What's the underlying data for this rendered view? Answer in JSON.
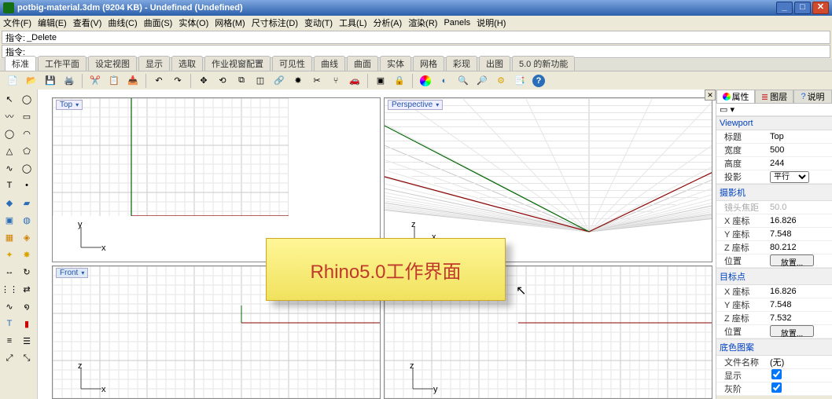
{
  "title": "potbig-material.3dm (9204 KB) - Undefined (Undefined)",
  "menu": [
    "文件(F)",
    "编辑(E)",
    "查看(V)",
    "曲线(C)",
    "曲面(S)",
    "实体(O)",
    "网格(M)",
    "尺寸标注(D)",
    "变动(T)",
    "工具(L)",
    "分析(A)",
    "渲染(R)",
    "Panels",
    "说明(H)"
  ],
  "cmd1_label": "指令:",
  "cmd1_value": "_Delete",
  "cmd2_label": "指令:",
  "cmd2_value": "",
  "tabs": [
    "标准",
    "工作平面",
    "设定视图",
    "显示",
    "选取",
    "作业视窗配置",
    "可见性",
    "曲线",
    "曲面",
    "实体",
    "网格",
    "彩现",
    "出图",
    "5.0 的新功能"
  ],
  "view_top": "Top",
  "view_persp": "Perspective",
  "view_front": "Front",
  "rp_tabs": {
    "prop": "属性",
    "layer": "图层",
    "help": "说明"
  },
  "sections": {
    "viewport": "Viewport",
    "camera": "摄影机",
    "target": "目标点",
    "wallpaper": "底色图案"
  },
  "rows": {
    "title_l": "标题",
    "title_v": "Top",
    "width_l": "宽度",
    "width_v": "500",
    "height_l": "高度",
    "height_v": "244",
    "proj_l": "投影",
    "proj_v": "平行",
    "lens_l": "镜头焦距",
    "lens_v": "50.0",
    "cx_l": "X 座标",
    "cx_v": "16.826",
    "cy_l": "Y 座标",
    "cy_v": "7.548",
    "cz_l": "Z 座标",
    "cz_v": "80.212",
    "loc_l": "位置",
    "loc_btn": "放置...",
    "tx_l": "X 座标",
    "tx_v": "16.826",
    "ty_l": "Y 座标",
    "ty_v": "7.548",
    "tz_l": "Z 座标",
    "tz_v": "7.532",
    "tloc_l": "位置",
    "tloc_btn": "放置...",
    "file_l": "文件名称",
    "file_v": "(无)",
    "show_l": "显示",
    "gray_l": "灰阶"
  },
  "callout": "Rhino5.0工作界面"
}
